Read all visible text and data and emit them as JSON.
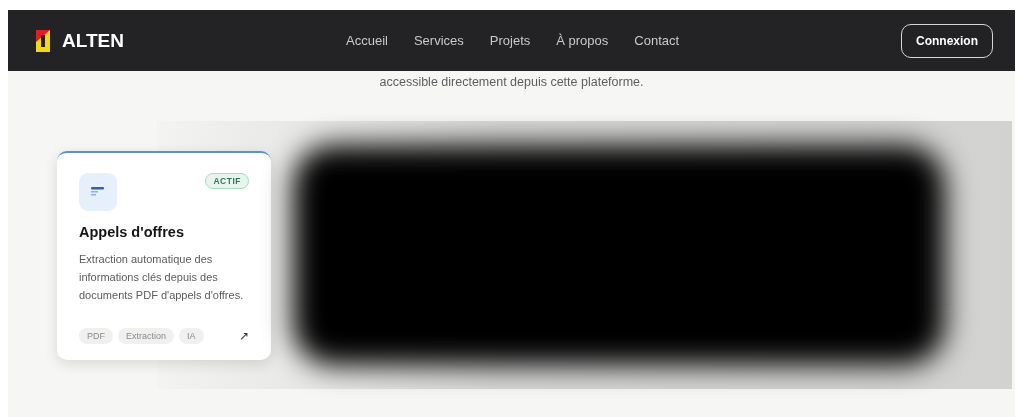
{
  "brand": {
    "name": "ALTEN"
  },
  "nav": {
    "links": [
      "Accueil",
      "Services",
      "Projets",
      "À propos",
      "Contact"
    ],
    "login": "Connexion"
  },
  "intro": "accessible directement depuis cette plateforme.",
  "cards": [
    {
      "title": "Appels d'offres",
      "status": "ACTIF",
      "description": "Extraction automatique des informations clés depuis des documents PDF d'appels d'offres.",
      "tags": [
        "PDF",
        "Extraction",
        "IA"
      ],
      "arrow": "↗"
    }
  ]
}
